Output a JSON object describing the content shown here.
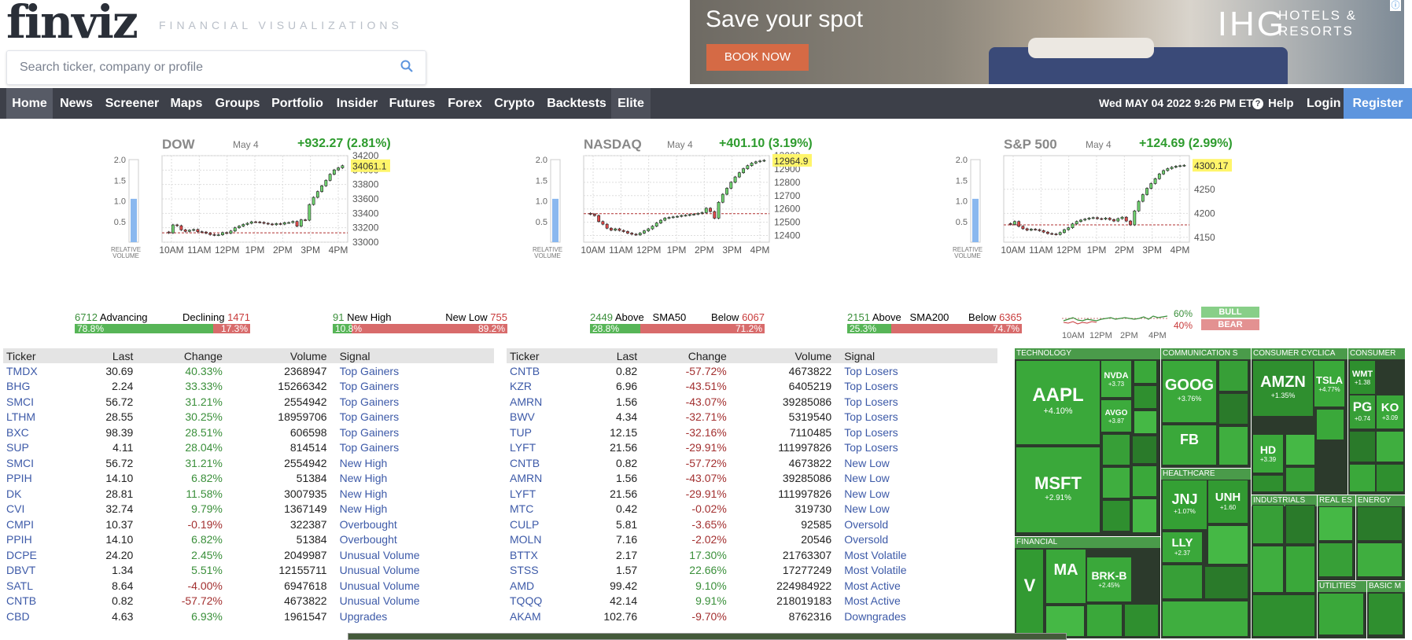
{
  "logo": "finviz",
  "tagline": "FINANCIAL VISUALIZATIONS",
  "search": {
    "placeholder": "Search ticker, company or profile"
  },
  "ad": {
    "headline": "Save your spot",
    "cta": "BOOK NOW",
    "brand": "IHG",
    "brand_sub": "HOTELS & RESORTS"
  },
  "nav": {
    "items": [
      "Home",
      "News",
      "Screener",
      "Maps",
      "Groups",
      "Portfolio",
      "Insider",
      "Futures",
      "Forex",
      "Crypto",
      "Backtests",
      "Elite"
    ],
    "date": "Wed MAY 04 2022 9:26 PM ET",
    "help": "Help",
    "login": "Login",
    "register": "Register"
  },
  "colors": {
    "up": "#2d9b2d",
    "down": "#c83a3a",
    "nav": "#3d4049",
    "register": "#5d95de",
    "link": "#3d5aa8"
  },
  "chart_data": [
    {
      "type": "candlestick",
      "title": "DOW",
      "date": "May 4",
      "change": "+932.27 (2.81%)",
      "last": "34061.1",
      "x_ticks": [
        "10AM",
        "11AM",
        "12PM",
        "1PM",
        "2PM",
        "3PM",
        "4PM"
      ],
      "y_ticks": [
        33000,
        33200,
        33400,
        33600,
        33800,
        34000,
        34200
      ],
      "ylim": [
        33000,
        34200
      ],
      "prev_close": 33129,
      "volume_ticks": [
        "2.0",
        "1.5",
        "1.0",
        "0.5"
      ],
      "relative_volume": 1.05,
      "volume_label": "RELATIVE VOLUME",
      "close": [
        33129,
        33240,
        33228,
        33170,
        33150,
        33165,
        33175,
        33145,
        33140,
        33125,
        33105,
        33098,
        33102,
        33132,
        33125,
        33155,
        33200,
        33222,
        33246,
        33262,
        33282,
        33280,
        33274,
        33262,
        33252,
        33242,
        33257,
        33250,
        33270,
        33272,
        33287,
        33222,
        33310,
        33305,
        33522,
        33622,
        33702,
        33782,
        33857,
        33942,
        34002,
        34031,
        34061
      ]
    },
    {
      "type": "candlestick",
      "title": "NASDAQ",
      "date": "May 4",
      "change": "+401.10 (3.19%)",
      "last": "12964.9",
      "x_ticks": [
        "10AM",
        "11AM",
        "12PM",
        "1PM",
        "2PM",
        "3PM",
        "4PM"
      ],
      "y_ticks": [
        12400,
        12500,
        12600,
        12700,
        12800,
        12900,
        13000
      ],
      "ylim": [
        12350,
        13000
      ],
      "prev_close": 12564,
      "volume_ticks": [
        "2.0",
        "1.5",
        "1.0",
        "0.5"
      ],
      "relative_volume": 1.05,
      "volume_label": "RELATIVE VOLUME",
      "close": [
        12560,
        12550,
        12505,
        12485,
        12455,
        12440,
        12450,
        12438,
        12430,
        12418,
        12410,
        12405,
        12418,
        12435,
        12450,
        12470,
        12494,
        12515,
        12531,
        12535,
        12540,
        12544,
        12550,
        12552,
        12557,
        12560,
        12566,
        12572,
        12605,
        12580,
        12530,
        12650,
        12710,
        12755,
        12800,
        12840,
        12872,
        12902,
        12925,
        12944,
        12954,
        12960,
        12965
      ]
    },
    {
      "type": "candlestick",
      "title": "S&P 500",
      "date": "May 4",
      "change": "+124.69 (2.99%)",
      "last": "4300.17",
      "x_ticks": [
        "10AM",
        "11AM",
        "12PM",
        "1PM",
        "2PM",
        "3PM",
        "4PM"
      ],
      "y_ticks": [
        4150,
        4200,
        4250
      ],
      "ylim": [
        4140,
        4320
      ],
      "prev_close": 4176,
      "volume_ticks": [
        "2.0",
        "1.5",
        "1.0",
        "0.5"
      ],
      "relative_volume": 1.05,
      "volume_label": "RELATIVE VOLUME",
      "close": [
        4177,
        4183,
        4173,
        4168,
        4165,
        4167,
        4166,
        4164,
        4161,
        4158,
        4157,
        4156,
        4160,
        4166,
        4170,
        4178,
        4183,
        4186,
        4188,
        4190,
        4191,
        4189,
        4188,
        4190,
        4187,
        4184,
        4189,
        4192,
        4184,
        4176,
        4205,
        4225,
        4239,
        4252,
        4262,
        4272,
        4282,
        4289,
        4293,
        4296,
        4298,
        4299,
        4300
      ]
    }
  ],
  "breadth": [
    {
      "l_num": "6712",
      "l_label": "Advancing",
      "r_label": "Declining",
      "r_num": "1471",
      "l_pct": "78.8%",
      "r_pct": "17.3%",
      "g_frac": 0.788,
      "r_frac": 0.173
    },
    {
      "l_num": "91",
      "l_label": "New High",
      "r_label": "New Low",
      "r_num": "755",
      "l_pct": "10.8%",
      "r_pct": "89.2%",
      "g_frac": 0.108,
      "r_frac": 0.892
    },
    {
      "l_num": "2449",
      "l_label": "Above",
      "m_label": "SMA50",
      "r_label": "Below",
      "r_num": "6067",
      "l_pct": "28.8%",
      "r_pct": "71.2%",
      "g_frac": 0.288,
      "r_frac": 0.712
    },
    {
      "l_num": "2151",
      "l_label": "Above",
      "m_label": "SMA200",
      "r_label": "Below",
      "r_num": "6365",
      "l_pct": "25.3%",
      "r_pct": "74.7%",
      "g_frac": 0.253,
      "r_frac": 0.747
    }
  ],
  "sentiment": {
    "bull_pct": "60%",
    "bear_pct": "40%",
    "bull": "BULL",
    "bear": "BEAR",
    "x_ticks": [
      "10AM",
      "12PM",
      "2PM",
      "4PM"
    ]
  },
  "table_headers": [
    "Ticker",
    "Last",
    "Change",
    "Volume",
    "Signal"
  ],
  "gainers": [
    [
      "TMDX",
      "30.69",
      "40.33%",
      "2368947",
      "Top Gainers"
    ],
    [
      "BHG",
      "2.24",
      "33.33%",
      "15266342",
      "Top Gainers"
    ],
    [
      "SMCI",
      "56.72",
      "31.21%",
      "2554942",
      "Top Gainers"
    ],
    [
      "LTHM",
      "28.55",
      "30.25%",
      "18959706",
      "Top Gainers"
    ],
    [
      "BXC",
      "98.39",
      "28.51%",
      "606598",
      "Top Gainers"
    ],
    [
      "SUP",
      "4.11",
      "28.04%",
      "814514",
      "Top Gainers"
    ],
    [
      "SMCI",
      "56.72",
      "31.21%",
      "2554942",
      "New High"
    ],
    [
      "PPIH",
      "14.10",
      "6.82%",
      "51384",
      "New High"
    ],
    [
      "DK",
      "28.81",
      "11.58%",
      "3007935",
      "New High"
    ],
    [
      "CVI",
      "32.74",
      "9.79%",
      "1367149",
      "New High"
    ],
    [
      "CMPI",
      "10.37",
      "-0.19%",
      "322387",
      "Overbought"
    ],
    [
      "PPIH",
      "14.10",
      "6.82%",
      "51384",
      "Overbought"
    ],
    [
      "DCPE",
      "24.20",
      "2.45%",
      "2049987",
      "Unusual Volume"
    ],
    [
      "DBVT",
      "1.34",
      "5.51%",
      "12155711",
      "Unusual Volume"
    ],
    [
      "SATL",
      "8.64",
      "-4.00%",
      "6947618",
      "Unusual Volume"
    ],
    [
      "CNTB",
      "0.82",
      "-57.72%",
      "4673822",
      "Unusual Volume"
    ],
    [
      "CBD",
      "4.63",
      "6.93%",
      "1961547",
      "Upgrades"
    ]
  ],
  "losers": [
    [
      "CNTB",
      "0.82",
      "-57.72%",
      "4673822",
      "Top Losers"
    ],
    [
      "KZR",
      "6.96",
      "-43.51%",
      "6405219",
      "Top Losers"
    ],
    [
      "AMRN",
      "1.56",
      "-43.07%",
      "39285086",
      "Top Losers"
    ],
    [
      "BWV",
      "4.34",
      "-32.71%",
      "5319540",
      "Top Losers"
    ],
    [
      "TUP",
      "12.15",
      "-32.16%",
      "7110485",
      "Top Losers"
    ],
    [
      "LYFT",
      "21.56",
      "-29.91%",
      "111997826",
      "Top Losers"
    ],
    [
      "CNTB",
      "0.82",
      "-57.72%",
      "4673822",
      "New Low"
    ],
    [
      "AMRN",
      "1.56",
      "-43.07%",
      "39285086",
      "New Low"
    ],
    [
      "LYFT",
      "21.56",
      "-29.91%",
      "111997826",
      "New Low"
    ],
    [
      "MTC",
      "0.42",
      "-0.02%",
      "319730",
      "New Low"
    ],
    [
      "CULP",
      "5.81",
      "-3.65%",
      "92585",
      "Oversold"
    ],
    [
      "MOLN",
      "7.16",
      "-2.02%",
      "20546",
      "Oversold"
    ],
    [
      "BTTX",
      "2.17",
      "17.30%",
      "21763307",
      "Most Volatile"
    ],
    [
      "STSS",
      "1.57",
      "22.66%",
      "17277249",
      "Most Volatile"
    ],
    [
      "AMD",
      "99.42",
      "9.10%",
      "224984922",
      "Most Active"
    ],
    [
      "TQQQ",
      "42.14",
      "9.91%",
      "218019183",
      "Most Active"
    ],
    [
      "AKAM",
      "102.76",
      "-9.70%",
      "8762316",
      "Downgrades"
    ]
  ],
  "heatmap": {
    "sectors": [
      "TECHNOLOGY",
      "COMMUNICATION S",
      "CONSUMER CYCLICA",
      "CONSUMER",
      "HEALTHCARE",
      "FINANCIAL",
      "INDUSTRIALS",
      "REAL ES",
      "ENERGY",
      "UTILITIES",
      "BASIC M"
    ],
    "tiles": [
      {
        "t": "AAPL",
        "p": "+4.10%"
      },
      {
        "t": "MSFT",
        "p": "+2.91%"
      },
      {
        "t": "NVDA",
        "p": "+3.73"
      },
      {
        "t": "AVGO",
        "p": "+3.87"
      },
      {
        "t": "GOOG",
        "p": "+3.76%"
      },
      {
        "t": "FB",
        "p": ""
      },
      {
        "t": "AMZN",
        "p": "+1.35%"
      },
      {
        "t": "TSLA",
        "p": "+4.77%"
      },
      {
        "t": "PG",
        "p": "+0.74"
      },
      {
        "t": "KO",
        "p": "+3.09"
      },
      {
        "t": "JNJ",
        "p": "+1.07%"
      },
      {
        "t": "UNH",
        "p": "+1.60"
      },
      {
        "t": "LLY",
        "p": "+2.37"
      },
      {
        "t": "V",
        "p": ""
      },
      {
        "t": "MA",
        "p": ""
      },
      {
        "t": "BRK-B",
        "p": "+2.45%"
      },
      {
        "t": "HD",
        "p": "+3.39"
      },
      {
        "t": "WMT",
        "p": "+1.38"
      }
    ]
  }
}
